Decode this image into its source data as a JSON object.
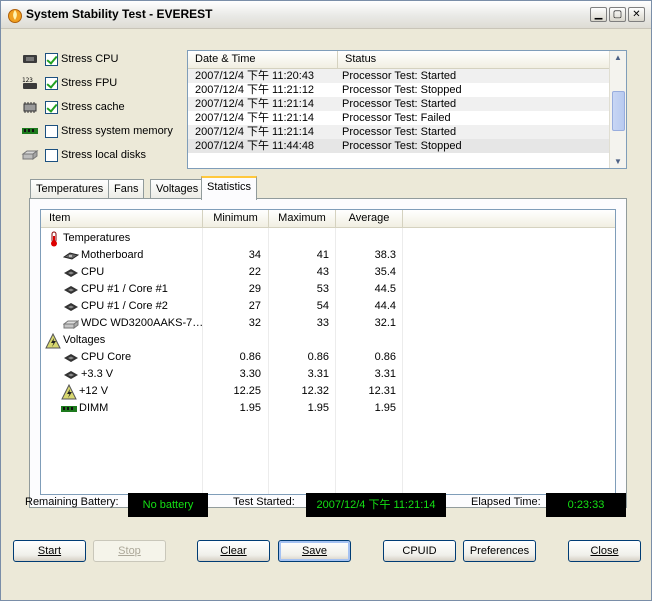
{
  "window": {
    "title": "System Stability Test - EVEREST"
  },
  "stress": [
    {
      "label": "Stress CPU",
      "checked": true,
      "icon": "cpu-chip-icon"
    },
    {
      "label": "Stress FPU",
      "checked": true,
      "icon": "fpu-chip-icon"
    },
    {
      "label": "Stress cache",
      "checked": true,
      "icon": "cache-chip-icon"
    },
    {
      "label": "Stress system memory",
      "checked": false,
      "icon": "memory-module-icon"
    },
    {
      "label": "Stress local disks",
      "checked": false,
      "icon": "hard-disk-icon"
    }
  ],
  "log": {
    "headers": {
      "date": "Date & Time",
      "status": "Status"
    },
    "rows": [
      {
        "date": "2007/12/4 下午 11:20:43",
        "status": "Processor Test: Started"
      },
      {
        "date": "2007/12/4 下午 11:21:12",
        "status": "Processor Test: Stopped"
      },
      {
        "date": "2007/12/4 下午 11:21:14",
        "status": "Processor Test: Started"
      },
      {
        "date": "2007/12/4 下午 11:21:14",
        "status": "Processor Test: Failed"
      },
      {
        "date": "2007/12/4 下午 11:21:14",
        "status": "Processor Test: Started"
      },
      {
        "date": "2007/12/4 下午 11:44:48",
        "status": "Processor Test: Stopped"
      }
    ]
  },
  "tabs": [
    "Temperatures",
    "Fans",
    "Voltages",
    "Statistics"
  ],
  "active_tab": "Statistics",
  "stats": {
    "headers": {
      "item": "Item",
      "min": "Minimum",
      "max": "Maximum",
      "avg": "Average"
    },
    "rows": [
      {
        "type": "group",
        "label": "Temperatures",
        "icon": "thermometer-icon"
      },
      {
        "type": "item",
        "label": "Motherboard",
        "icon": "motherboard-icon",
        "min": "34",
        "max": "41",
        "avg": "38.3"
      },
      {
        "type": "item",
        "label": "CPU",
        "icon": "cpu-chip-icon",
        "min": "22",
        "max": "43",
        "avg": "35.4"
      },
      {
        "type": "item",
        "label": "CPU #1 / Core #1",
        "icon": "cpu-chip-icon",
        "min": "29",
        "max": "53",
        "avg": "44.5"
      },
      {
        "type": "item",
        "label": "CPU #1 / Core #2",
        "icon": "cpu-chip-icon",
        "min": "27",
        "max": "54",
        "avg": "44.4"
      },
      {
        "type": "item",
        "label": "WDC WD3200AAKS-7…",
        "icon": "hard-disk-icon",
        "min": "32",
        "max": "33",
        "avg": "32.1"
      },
      {
        "type": "group",
        "label": "Voltages",
        "icon": "voltage-warning-icon"
      },
      {
        "type": "item",
        "label": "CPU Core",
        "icon": "cpu-chip-icon",
        "min": "0.86",
        "max": "0.86",
        "avg": "0.86"
      },
      {
        "type": "item",
        "label": "+3.3 V",
        "icon": "cpu-chip-icon",
        "min": "3.30",
        "max": "3.31",
        "avg": "3.31"
      },
      {
        "type": "item",
        "label": "+12 V",
        "icon": "voltage-warning-icon",
        "min": "12.25",
        "max": "12.32",
        "avg": "12.31"
      },
      {
        "type": "item",
        "label": "DIMM",
        "icon": "memory-module-icon",
        "min": "1.95",
        "max": "1.95",
        "avg": "1.95"
      }
    ]
  },
  "status": {
    "battery_label": "Remaining Battery:",
    "battery_value": "No battery",
    "started_label": "Test Started:",
    "started_value": "2007/12/4 下午 11:21:14",
    "elapsed_label": "Elapsed Time:",
    "elapsed_value": "0:23:33"
  },
  "buttons": {
    "start": "Start",
    "stop": "Stop",
    "clear": "Clear",
    "save": "Save",
    "cpuid": "CPUID",
    "preferences": "Preferences",
    "close": "Close"
  },
  "colors": {
    "led_text": "#14e014",
    "led_bg": "#000000",
    "tab_highlight": "#ffc83c"
  }
}
